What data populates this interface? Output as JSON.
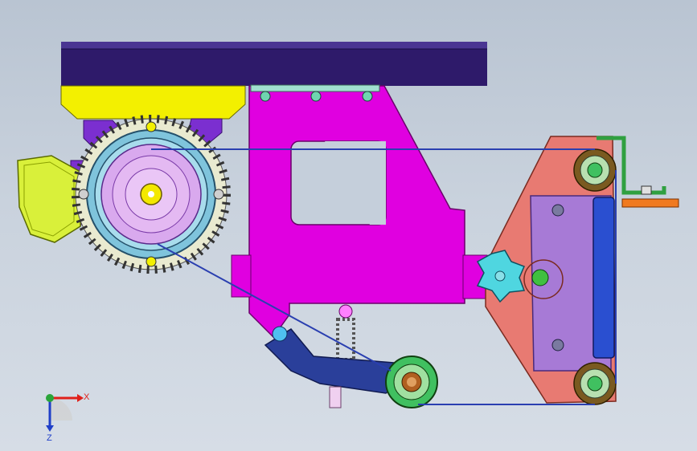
{
  "viewport": {
    "background": "#c5cfdb"
  },
  "triad": {
    "x_label": "X",
    "z_label": "Z",
    "x_color": "#e0201a",
    "y_color": "#2aa53a",
    "z_color": "#1f3fc8"
  },
  "colors": {
    "top_rail": "#2e1a6a",
    "motor_mount": "#f3f000",
    "motor_frame": "#7b2fd0",
    "motor_body": "#7fc4dc",
    "terminal_box": "#d9f03a",
    "main_arm": "#e000e0",
    "tension_arm": "#2a3f9a",
    "belt_plate": "#e87a72",
    "sub_plate": "#a77ad6",
    "platen": "#2a4fd0",
    "knob": "#4fd6e0",
    "idler": "#40c060",
    "bracket": "#30a040",
    "tab": "#f07a20",
    "belt": "#2a3fb0"
  }
}
